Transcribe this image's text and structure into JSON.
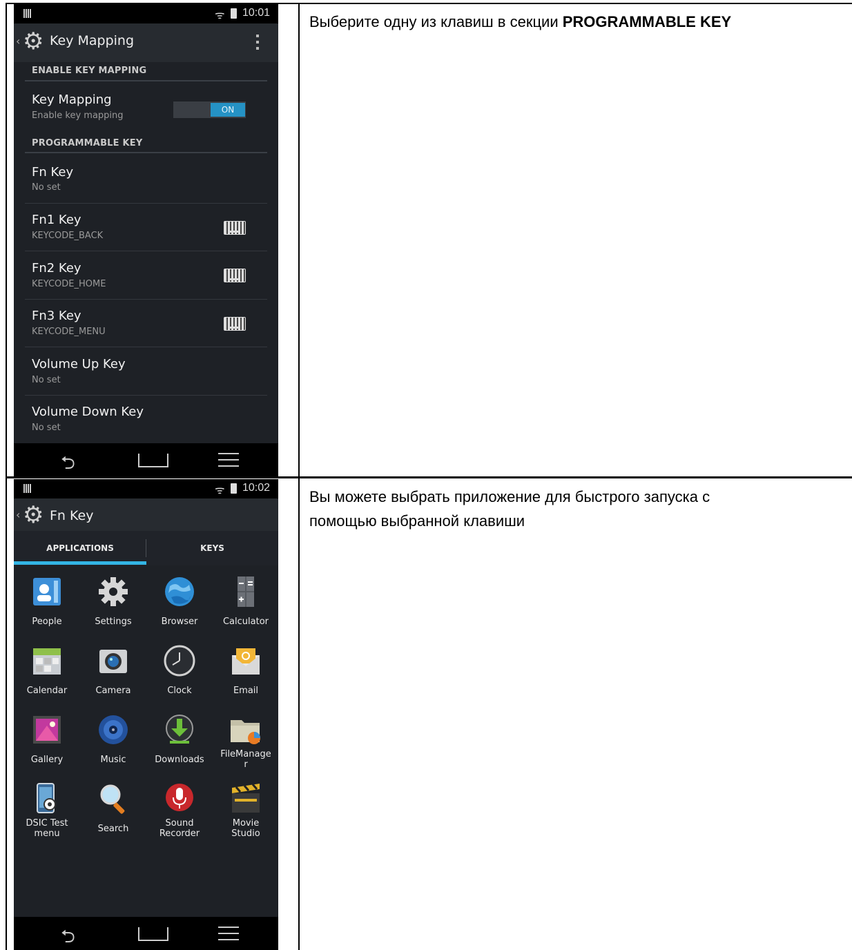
{
  "rows": [
    {
      "description_plain": "Выберите одну из клавиш в секции ",
      "description_bold": "PROGRAMMABLE KEY"
    },
    {
      "description_lines": [
        "Вы можете выбрать приложение для быстрого запуска с",
        "помощью выбранной клавиши"
      ]
    }
  ],
  "screen1": {
    "status_time": "10:01",
    "title": "Key Mapping",
    "section_enable": "ENABLE KEY MAPPING",
    "key_mapping": {
      "title": "Key Mapping",
      "subtitle": "Enable key mapping",
      "toggle": "ON"
    },
    "section_programmable": "PROGRAMMABLE KEY",
    "items": [
      {
        "title": "Fn Key",
        "subtitle": "No set"
      },
      {
        "title": "Fn1 Key",
        "subtitle": "KEYCODE_BACK"
      },
      {
        "title": "Fn2 Key",
        "subtitle": "KEYCODE_HOME"
      },
      {
        "title": "Fn3 Key",
        "subtitle": "KEYCODE_MENU"
      },
      {
        "title": "Volume Up Key",
        "subtitle": "No set"
      },
      {
        "title": "Volume Down Key",
        "subtitle": "No set"
      }
    ]
  },
  "screen2": {
    "status_time": "10:02",
    "title": "Fn Key",
    "tabs": [
      "APPLICATIONS",
      "KEYS"
    ],
    "apps": [
      {
        "label": "People",
        "icon": "people-icon"
      },
      {
        "label": "Settings",
        "icon": "settings-icon"
      },
      {
        "label": "Browser",
        "icon": "browser-icon"
      },
      {
        "label": "Calculator",
        "icon": "calculator-icon"
      },
      {
        "label": "Calendar",
        "icon": "calendar-icon"
      },
      {
        "label": "Camera",
        "icon": "camera-icon"
      },
      {
        "label": "Clock",
        "icon": "clock-icon"
      },
      {
        "label": "Email",
        "icon": "email-icon"
      },
      {
        "label": "Gallery",
        "icon": "gallery-icon"
      },
      {
        "label": "Music",
        "icon": "music-icon"
      },
      {
        "label": "Downloads",
        "icon": "downloads-icon"
      },
      {
        "label": "FileManage\nr",
        "icon": "file-manager-icon"
      },
      {
        "label": "DSIC Test\nmenu",
        "icon": "dsic-test-icon"
      },
      {
        "label": "Search",
        "icon": "search-icon"
      },
      {
        "label": "Sound\nRecorder",
        "icon": "sound-recorder-icon"
      },
      {
        "label": "Movie\nStudio",
        "icon": "movie-studio-icon"
      }
    ]
  },
  "colors": {
    "accent": "#33b5e5",
    "toggle_on": "#2592c5",
    "screen_bg": "#1e2126"
  }
}
